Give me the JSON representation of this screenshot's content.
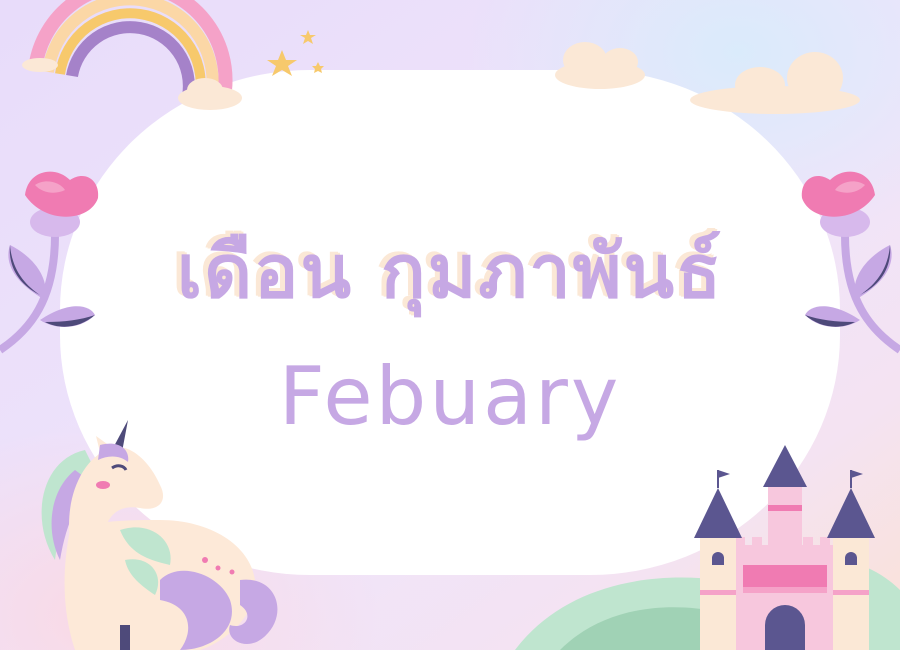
{
  "title": {
    "thai": "เดือน กุมภาพันธ์",
    "english": "Febuary"
  },
  "colors": {
    "background": "#ece0fb",
    "oval": "#ffffff",
    "lavender": "#c6a8e4",
    "pink": "#f07bb2",
    "purple": "#4e4a7a",
    "mint": "#bfe5cf",
    "cream": "#fbe8d6",
    "star": "#f7c96c"
  },
  "decorations": [
    "rainbow-icon",
    "star-icon",
    "cloud-icon",
    "flower-icon",
    "unicorn-icon",
    "castle-icon",
    "hill-icon"
  ]
}
